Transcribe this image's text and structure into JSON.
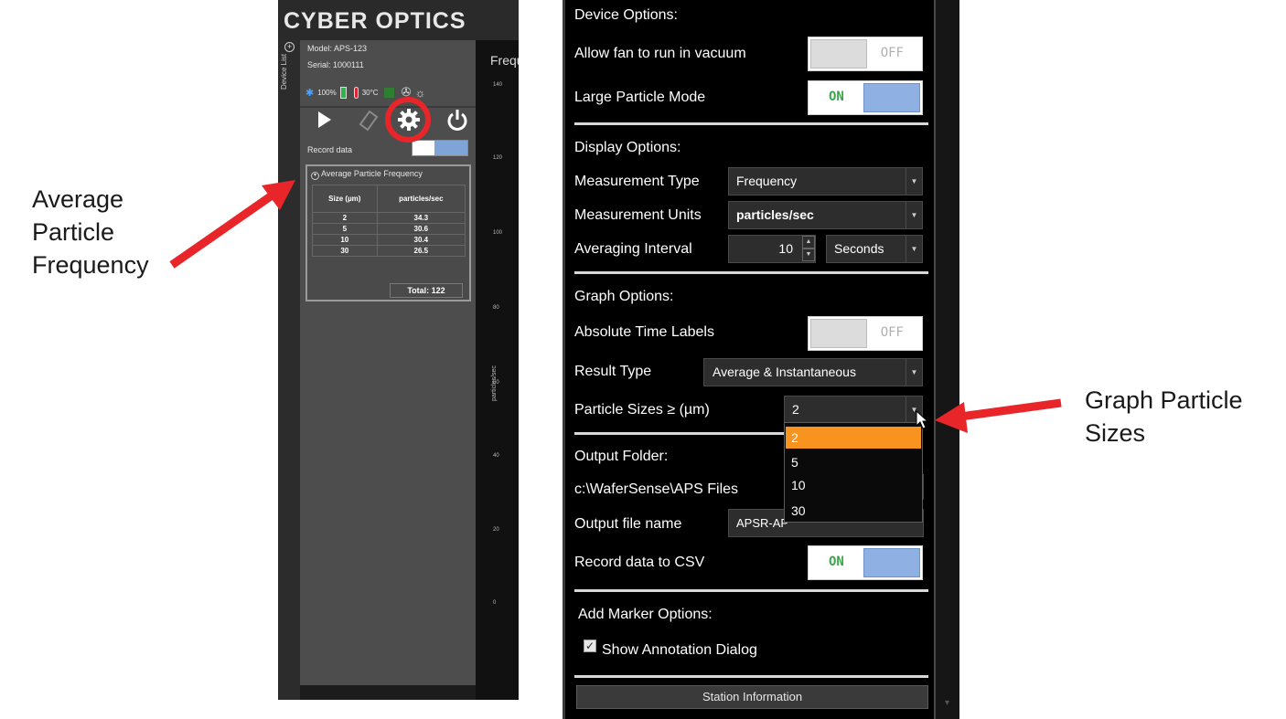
{
  "callouts": {
    "left_line1": "Average",
    "left_line2": "Particle",
    "left_line3": "Frequency",
    "right_line1": "Graph Particle",
    "right_line2": "Sizes"
  },
  "left_panel": {
    "logo": "CYBER OPTICS",
    "device_list_label": "Device List",
    "model": "Model: APS-123",
    "serial": "Serial: 1000111",
    "battery": "100%",
    "temperature": "30°C",
    "record_label": "Record data",
    "avg_title": "Average Particle Frequency",
    "table": {
      "headers": [
        "Size (µm)",
        "particles/sec"
      ],
      "rows": [
        [
          "2",
          "34.3"
        ],
        [
          "5",
          "30.6"
        ],
        [
          "10",
          "30.4"
        ],
        [
          "30",
          "26.5"
        ]
      ],
      "total_label": "Total: 122"
    },
    "graph_title": "Frequ",
    "graph_ylabel": "particles/sec",
    "ticks": [
      "140",
      "120",
      "100",
      "80",
      "60",
      "40",
      "20",
      "0"
    ]
  },
  "right_panel": {
    "device_options": "Device Options:",
    "allow_fan": "Allow fan to run in vacuum",
    "allow_fan_state": "OFF",
    "large_particle": "Large Particle Mode",
    "large_particle_state": "ON",
    "display_options": "Display Options:",
    "measurement_type_label": "Measurement Type",
    "measurement_type_value": "Frequency",
    "measurement_units_label": "Measurement Units",
    "measurement_units_value": "particles/sec",
    "averaging_interval_label": "Averaging Interval",
    "averaging_interval_value": "10",
    "averaging_unit": "Seconds",
    "graph_options": "Graph Options:",
    "absolute_time_label": "Absolute Time Labels",
    "absolute_time_state": "OFF",
    "result_type_label": "Result Type",
    "result_type_value": "Average & Instantaneous",
    "particle_sizes_label": "Particle Sizes ≥ (µm)",
    "particle_sizes_value": "2",
    "particle_sizes_options": [
      "2",
      "5",
      "10",
      "30"
    ],
    "output_folder_label": "Output Folder:",
    "output_folder_value": "c:\\WaferSense\\APS Files",
    "output_file_label": "Output file name",
    "output_file_value": "APSR-AP",
    "record_csv_label": "Record data to CSV",
    "record_csv_state": "ON",
    "marker_options": "Add Marker Options:",
    "show_annotation": "Show Annotation Dialog",
    "station_button": "Station Information"
  },
  "colors": {
    "accent_orange": "#f7931e",
    "toggle_blue": "#8fb0e3",
    "on_green": "#3aa64a",
    "arrow_red": "#e8262a"
  }
}
